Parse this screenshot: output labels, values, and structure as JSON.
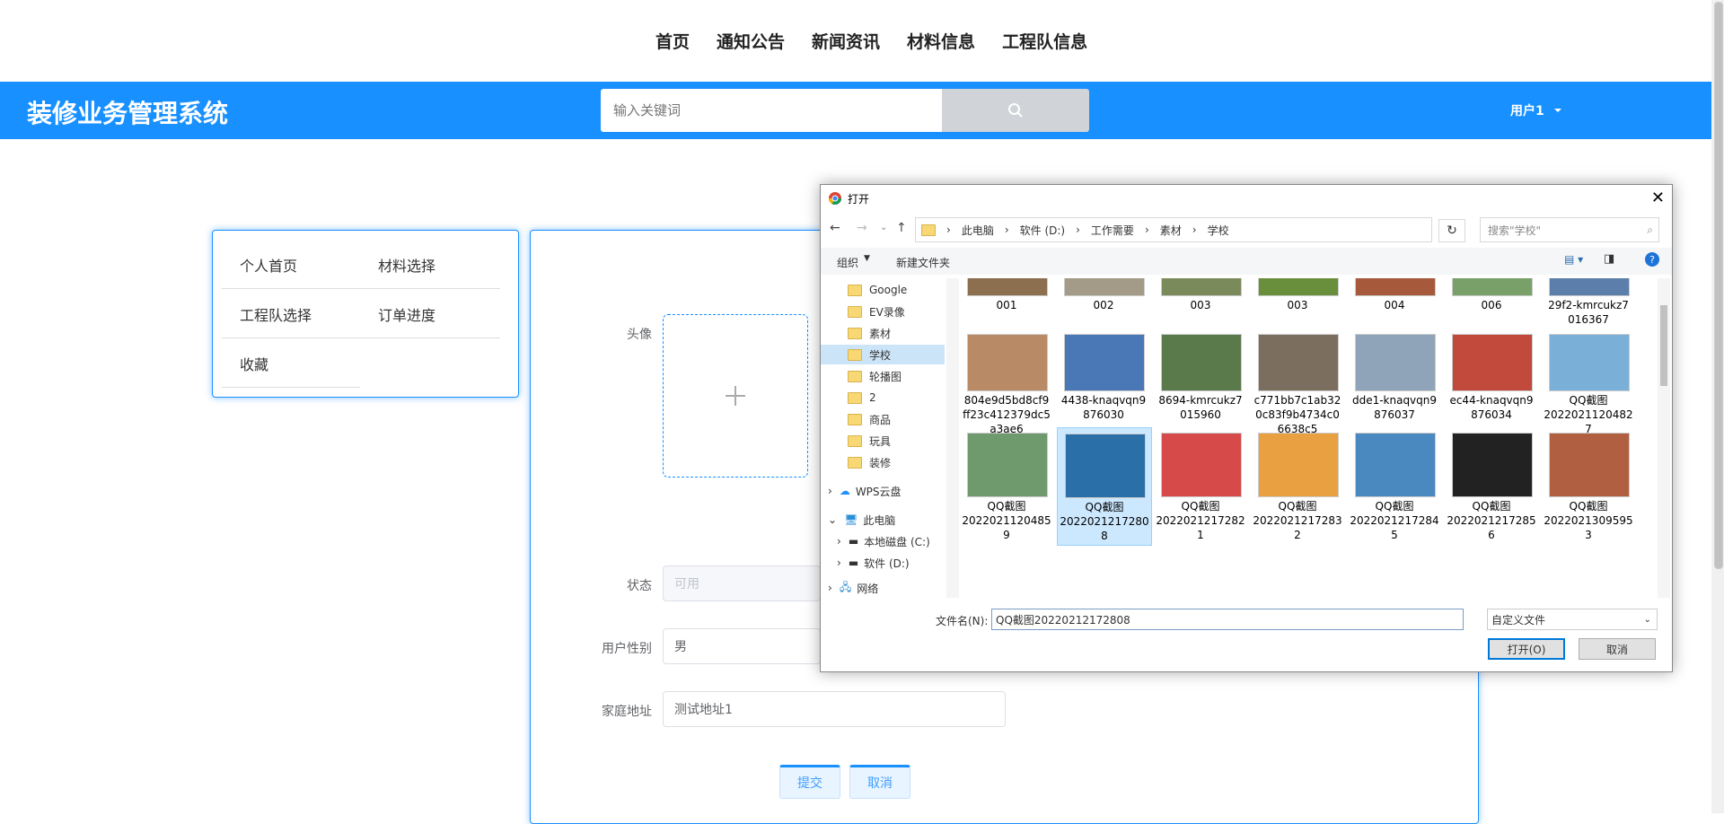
{
  "nav": {
    "links": [
      "首页",
      "通知公告",
      "新闻资讯",
      "材料信息",
      "工程队信息"
    ]
  },
  "header": {
    "title": "装修业务管理系统",
    "search_placeholder": "输入关键词",
    "user": "用户1",
    "color": "#1890ff"
  },
  "sidebar": {
    "items": [
      "个人首页",
      "材料选择",
      "工程队选择",
      "订单进度",
      "收藏"
    ]
  },
  "form": {
    "avatar_label": "头像",
    "status_label": "状态",
    "status_placeholder": "可用",
    "gender_label": "用户性别",
    "gender_value": "男",
    "address_label": "家庭地址",
    "address_value": "测试地址1",
    "submit": "提交",
    "cancel": "取消"
  },
  "dialog": {
    "title": "打开",
    "path": [
      "此电脑",
      "软件 (D:)",
      "工作需要",
      "素材",
      "学校"
    ],
    "search_placeholder": "搜索\"学校\"",
    "organize": "组织",
    "new_folder": "新建文件夹",
    "nav_items": [
      "Google",
      "EV录像",
      "素材",
      "学校",
      "轮播图",
      "2",
      "商品",
      "玩具",
      "装修",
      "WPS云盘",
      "此电脑",
      "本地磁盘 (C:)",
      "软件 (D:)",
      "网络"
    ],
    "files_row1": [
      "001",
      "002",
      "003",
      "003",
      "004",
      "006",
      "29f2-kmrcukz7\n016367"
    ],
    "files_row2": [
      "804e9d5bd8cf9\nff23c412379dc5\na3ae6",
      "4438-knaqvqn9\n876030",
      "8694-kmrcukz7\n015960",
      "c771bb7c1ab32\n0c83f9b4734c0\n6638c5",
      "dde1-knaqvqn9\n876037",
      "ec44-knaqvqn9\n876034",
      "QQ截图\n2022021120482\n7"
    ],
    "files_row3": [
      "QQ截图\n2022021120485\n9",
      "QQ截图\n2022021217280\n8",
      "QQ截图\n2022021217282\n1",
      "QQ截图\n2022021217283\n2",
      "QQ截图\n2022021217284\n5",
      "QQ截图\n2022021217285\n6",
      "QQ截图\n2022021309595\n3"
    ],
    "filename_label": "文件名(N):",
    "filename_value": "QQ截图20220212172808",
    "filetype": "自定义文件",
    "open_button": "打开(O)",
    "cancel_button": "取消"
  }
}
